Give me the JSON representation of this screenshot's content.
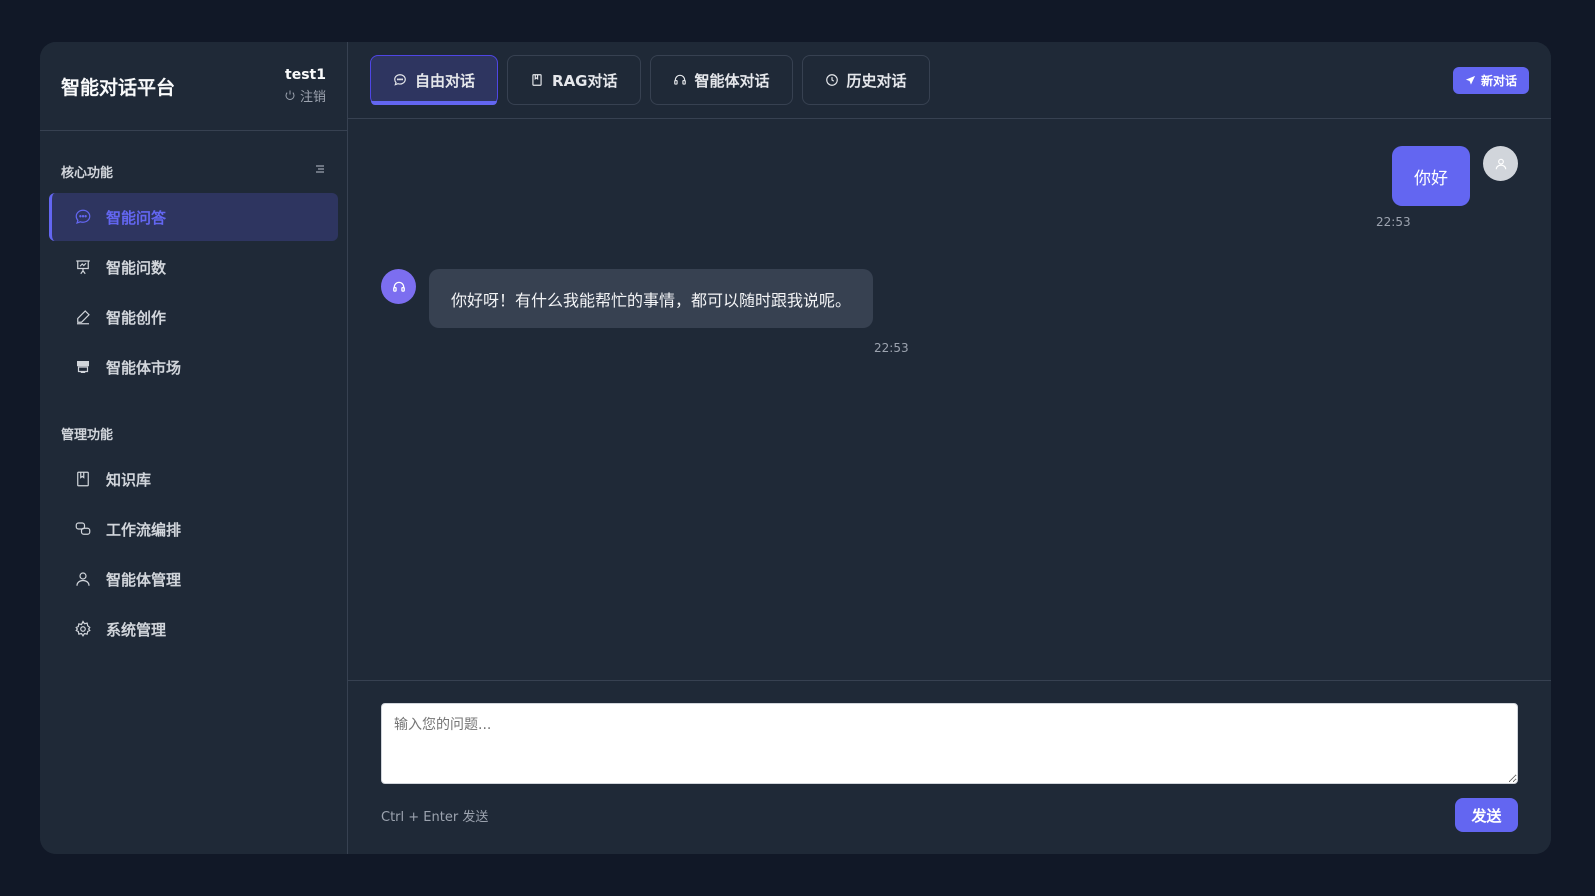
{
  "sidebar": {
    "brand": "智能对话平台",
    "user": {
      "name": "test1",
      "logout_label": "注销"
    },
    "section_core": "核心功能",
    "core_items": [
      {
        "label": "智能问答",
        "icon": "chat-bubble-icon",
        "active": true
      },
      {
        "label": "智能问数",
        "icon": "presentation-chart-icon"
      },
      {
        "label": "智能创作",
        "icon": "pen-icon"
      },
      {
        "label": "智能体市场",
        "icon": "store-icon"
      }
    ],
    "section_admin": "管理功能",
    "admin_items": [
      {
        "label": "知识库",
        "icon": "book-icon"
      },
      {
        "label": "工作流编排",
        "icon": "workflow-icon"
      },
      {
        "label": "智能体管理",
        "icon": "user-icon"
      },
      {
        "label": "系统管理",
        "icon": "gear-icon"
      }
    ]
  },
  "tabs": [
    {
      "label": "自由对话",
      "icon": "chat-icon",
      "active": true
    },
    {
      "label": "RAG对话",
      "icon": "book-icon"
    },
    {
      "label": "智能体对话",
      "icon": "headset-icon"
    },
    {
      "label": "历史对话",
      "icon": "clock-icon"
    }
  ],
  "new_chat_label": "新对话",
  "messages": {
    "user": {
      "text": "你好",
      "time": "22:53"
    },
    "bot": {
      "text": "你好呀！有什么我能帮忙的事情，都可以随时跟我说呢。",
      "time": "22:53"
    }
  },
  "composer": {
    "placeholder": "输入您的问题...",
    "hint": "Ctrl + Enter 发送",
    "send_label": "发送"
  },
  "colors": {
    "accent": "#6366f1",
    "background": "#111827",
    "panel": "#1f2937"
  }
}
